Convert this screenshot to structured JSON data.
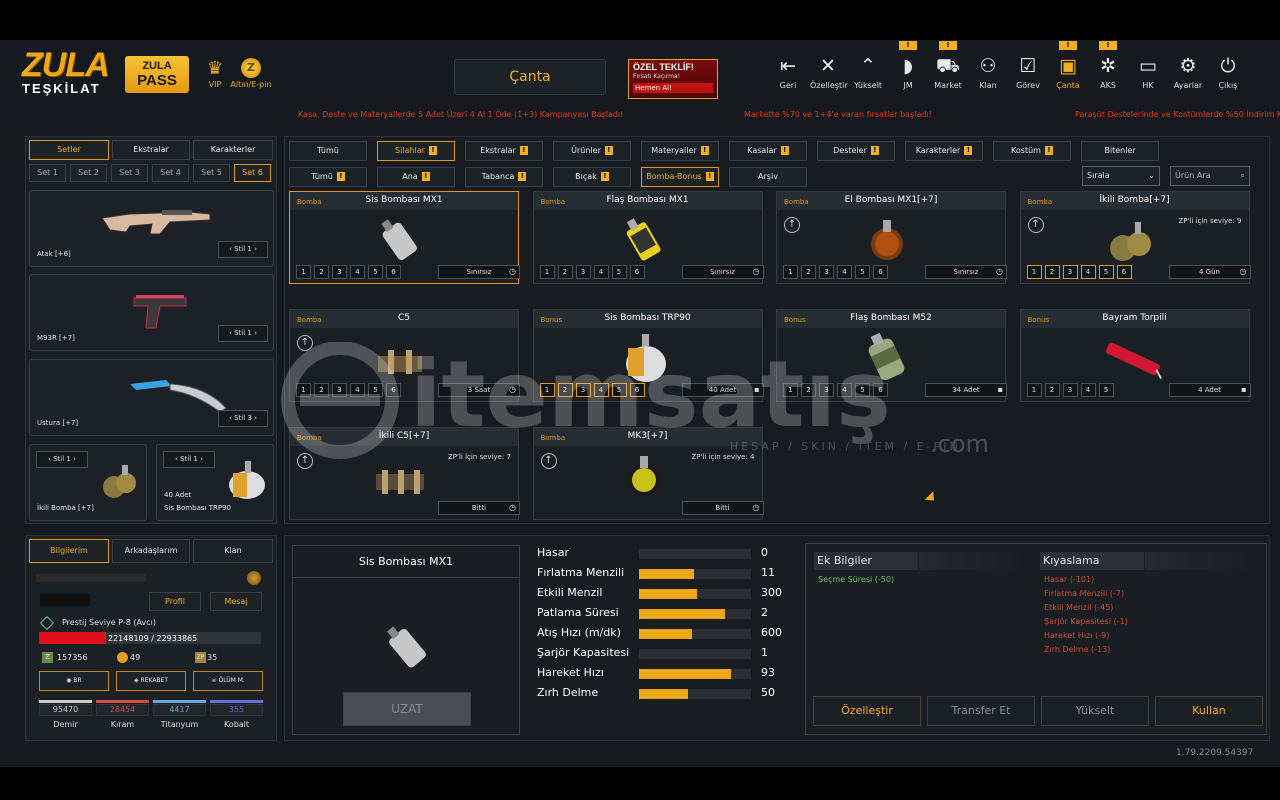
{
  "header": {
    "logo": {
      "line1": "ZULA",
      "line2": "TEŞKİLAT"
    },
    "pass": {
      "line1": "ZULA",
      "line2": "PASS"
    },
    "vip_label": "VIP",
    "coin_label": "Altın/E-pin",
    "center_title": "Çanta",
    "offer": {
      "title": "ÖZEL TEKLİF!",
      "sub": "Fırsatı Kaçırma!",
      "cta": "Hemen Al!"
    },
    "nav": [
      {
        "label": "Geri",
        "icon": "back-icon"
      },
      {
        "label": "Özelleştir",
        "icon": "tools-icon"
      },
      {
        "label": "Yükselt",
        "icon": "upgrade-icon"
      },
      {
        "label": "JM",
        "icon": "jm-icon"
      },
      {
        "label": "Market",
        "icon": "cart-icon"
      },
      {
        "label": "Klan",
        "icon": "clan-icon"
      },
      {
        "label": "Görev",
        "icon": "task-icon"
      },
      {
        "label": "Çanta",
        "icon": "bag-icon"
      },
      {
        "label": "AKS",
        "icon": "aks-icon"
      },
      {
        "label": "HK",
        "icon": "wallet-icon"
      },
      {
        "label": "Ayarlar",
        "icon": "gear-icon"
      },
      {
        "label": "Çıkış",
        "icon": "power-icon"
      }
    ],
    "alert_text": "!"
  },
  "ticker": [
    "Kasa, Deste ve Materyallerde 5 Adet Üzeri 4 Al 1 Öde (1+3) Kampanyası Başladı!",
    "Markette %70 ve 1+4'e varan fırsatlar başladı!",
    "Paraşüt Destelerinde ve Kostümlerde %50 İndirim K"
  ],
  "left": {
    "tabs": [
      "Setler",
      "Ekstralar",
      "Karakterler"
    ],
    "sets": [
      "Set 1",
      "Set 2",
      "Set 3",
      "Set 4",
      "Set 5",
      "Set 6"
    ],
    "weapons": [
      {
        "name": "Atak [+6]",
        "stil": "Stil 1"
      },
      {
        "name": "M93R [+7]",
        "stil": "Stil 1"
      },
      {
        "name": "Ustura [+7]",
        "stil": "Stil 3"
      }
    ],
    "slots": [
      {
        "name": "İkili Bomba [+7]",
        "stil": "Stil 1",
        "count": ""
      },
      {
        "name": "Sis Bombası TRP90",
        "stil": "Stil 1",
        "count": "40 Adet"
      }
    ]
  },
  "profile": {
    "tabs": [
      "Bilgilerim",
      "Arkadaşlarım",
      "Klan"
    ],
    "buttons": [
      "Profil",
      "Mesaj"
    ],
    "prestige": "Prestij Seviye P-8 (Avcı)",
    "xp": "22148109 / 22933865",
    "stats": [
      {
        "icon": "z-icon",
        "value": "157356"
      },
      {
        "icon": "coin-icon",
        "value": "49"
      },
      {
        "icon": "zp-icon",
        "value": "35"
      }
    ],
    "modes": [
      "BR",
      "REKABET",
      "ÖLÜM M."
    ],
    "resources": [
      {
        "label": "Demir",
        "value": "95470",
        "color": "#cccccc"
      },
      {
        "label": "Kıram",
        "value": "28454",
        "color": "#d04a4a"
      },
      {
        "label": "Titanyum",
        "value": "4417",
        "color": "#6aa6d8"
      },
      {
        "label": "Kobalt",
        "value": "355",
        "color": "#6a6ad8"
      }
    ]
  },
  "filters": {
    "row1": [
      {
        "label": "Tümü",
        "badge": false,
        "active": false
      },
      {
        "label": "Silahlar",
        "badge": true,
        "active": true
      },
      {
        "label": "Ekstralar",
        "badge": true,
        "active": false
      },
      {
        "label": "Ürünler",
        "badge": true,
        "active": false
      },
      {
        "label": "Materyaller",
        "badge": true,
        "active": false
      },
      {
        "label": "Kasalar",
        "badge": true,
        "active": false
      },
      {
        "label": "Desteler",
        "badge": true,
        "active": false
      },
      {
        "label": "Karakterler",
        "badge": true,
        "active": false
      },
      {
        "label": "Kostüm",
        "badge": true,
        "active": false
      },
      {
        "label": "Bitenler",
        "badge": false,
        "active": false
      }
    ],
    "row2": [
      {
        "label": "Tümü",
        "badge": true,
        "active": false
      },
      {
        "label": "Ana",
        "badge": true,
        "active": false
      },
      {
        "label": "Tabanca",
        "badge": true,
        "active": false
      },
      {
        "label": "Bıçak",
        "badge": true,
        "active": false
      },
      {
        "label": "Bomba-Bonus",
        "badge": true,
        "active": true
      },
      {
        "label": "Arşiv",
        "badge": false,
        "active": false
      }
    ],
    "sort_label": "Sırala",
    "search_placeholder": "Ürün Ara"
  },
  "items": [
    {
      "cat": "Bomba",
      "name": "Sis Bombası MX1",
      "dur": "Sınırsız",
      "durIcon": "clock-icon",
      "selected": true,
      "upgrade": false,
      "zp": "",
      "lvl": 6,
      "on": 0
    },
    {
      "cat": "Bomba",
      "name": "Flaş Bombası MX1",
      "dur": "Sınırsız",
      "durIcon": "clock-icon",
      "selected": false,
      "upgrade": false,
      "zp": "",
      "lvl": 6,
      "on": 0
    },
    {
      "cat": "Bomba",
      "name": "El Bombası MX1[+7]",
      "dur": "Sınırsız",
      "durIcon": "clock-icon",
      "selected": false,
      "upgrade": true,
      "zp": "",
      "lvl": 6,
      "on": 0
    },
    {
      "cat": "Bomba",
      "name": "İkili Bomba[+7]",
      "dur": "4 Gün",
      "durIcon": "clock-icon",
      "selected": false,
      "upgrade": true,
      "zp": "ZP'li için seviye: 9",
      "lvl": 6,
      "on": 6
    },
    {
      "cat": "Bomba",
      "name": "C5",
      "dur": "3 Saat",
      "durIcon": "clock-icon",
      "selected": false,
      "upgrade": true,
      "zp": "",
      "lvl": 6,
      "on": 0
    },
    {
      "cat": "Bonus",
      "name": "Sis Bombası TRP90",
      "dur": "40 Adet",
      "durIcon": "box-icon",
      "selected": false,
      "upgrade": false,
      "zp": "",
      "lvl": 6,
      "on": 6
    },
    {
      "cat": "Bonus",
      "name": "Flaş Bombası M52",
      "dur": "34 Adet",
      "durIcon": "box-icon",
      "selected": false,
      "upgrade": false,
      "zp": "",
      "lvl": 6,
      "on": 0
    },
    {
      "cat": "Bonus",
      "name": "Bayram Torpili",
      "dur": "4 Adet",
      "durIcon": "box-icon",
      "selected": false,
      "upgrade": false,
      "zp": "",
      "lvl": 5,
      "on": 0
    },
    {
      "cat": "Bomba",
      "name": "İkili C5[+7]",
      "dur": "Bitti",
      "durIcon": "clock-icon",
      "selected": false,
      "upgrade": true,
      "zp": "ZP'li için seviye: 7",
      "lvl": 0,
      "on": 0
    },
    {
      "cat": "Bomba",
      "name": "MK3[+7]",
      "dur": "Bitti",
      "durIcon": "clock-icon",
      "selected": false,
      "upgrade": true,
      "zp": "ZP'li için seviye: 4",
      "lvl": 0,
      "on": 0
    }
  ],
  "detail": {
    "name": "Sis Bombası MX1",
    "extend_button": "UZAT",
    "stats": [
      {
        "label": "Hasar",
        "value": "0",
        "fill": 0.0
      },
      {
        "label": "Fırlatma Menzili",
        "value": "11",
        "fill": 0.49
      },
      {
        "label": "Etkili Menzil",
        "value": "300",
        "fill": 0.52
      },
      {
        "label": "Patlama Süresi",
        "value": "2",
        "fill": 0.77
      },
      {
        "label": "Atış Hızı (m/dk)",
        "value": "600",
        "fill": 0.47
      },
      {
        "label": "Şarjör Kapasitesi",
        "value": "1",
        "fill": 0.0
      },
      {
        "label": "Hareket Hızı",
        "value": "93",
        "fill": 0.82
      },
      {
        "label": "Zırh Delme",
        "value": "50",
        "fill": 0.44
      }
    ]
  },
  "info": {
    "extra_title": "Ek Bilgiler",
    "extra": [
      "Seçme Süresi (-50)"
    ],
    "compare_title": "Kıyaslama",
    "compare": [
      "Hasar (-101)",
      "Fırlatma Menzili (-7)",
      "Etkili Menzil (-45)",
      "Şarjör Kapasitesi (-1)",
      "Hareket Hızı (-9)",
      "Zırh Delme (-13)"
    ]
  },
  "actions": [
    {
      "label": "Özelleştir",
      "active": true
    },
    {
      "label": "Transfer Et",
      "active": false
    },
    {
      "label": "Yükselt",
      "active": false
    },
    {
      "label": "Kullan",
      "active": true
    }
  ],
  "watermark": {
    "main": "itemsatış",
    "sub": "HESAP / SKIN / ITEM / E-PIN",
    "suffix": ".com"
  },
  "version": "1.79.2209.54397"
}
